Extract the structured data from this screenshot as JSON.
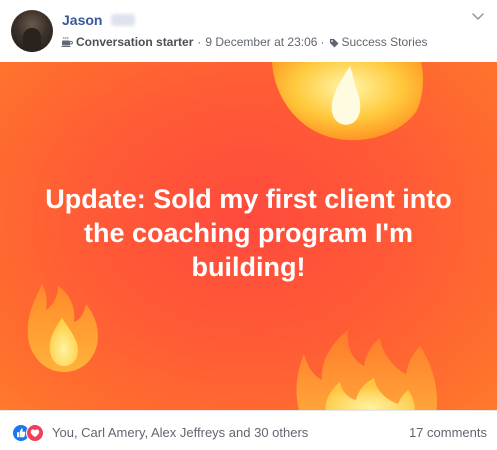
{
  "post": {
    "author": "Jason",
    "badge": "Conversation starter",
    "separator1": "·",
    "timestamp": "9 December at 23:06",
    "separator2": "·",
    "topic": "Success Stories",
    "banner_text": "Update: Sold my first client into the coaching program I'm building!",
    "banner_color": "#ff5a36"
  },
  "footer": {
    "reactions_text": "You, Carl Amery, Alex Jeffreys and 30 others",
    "comments_text": "17 comments",
    "like_color": "#1877f2",
    "love_color": "#f33e58"
  }
}
